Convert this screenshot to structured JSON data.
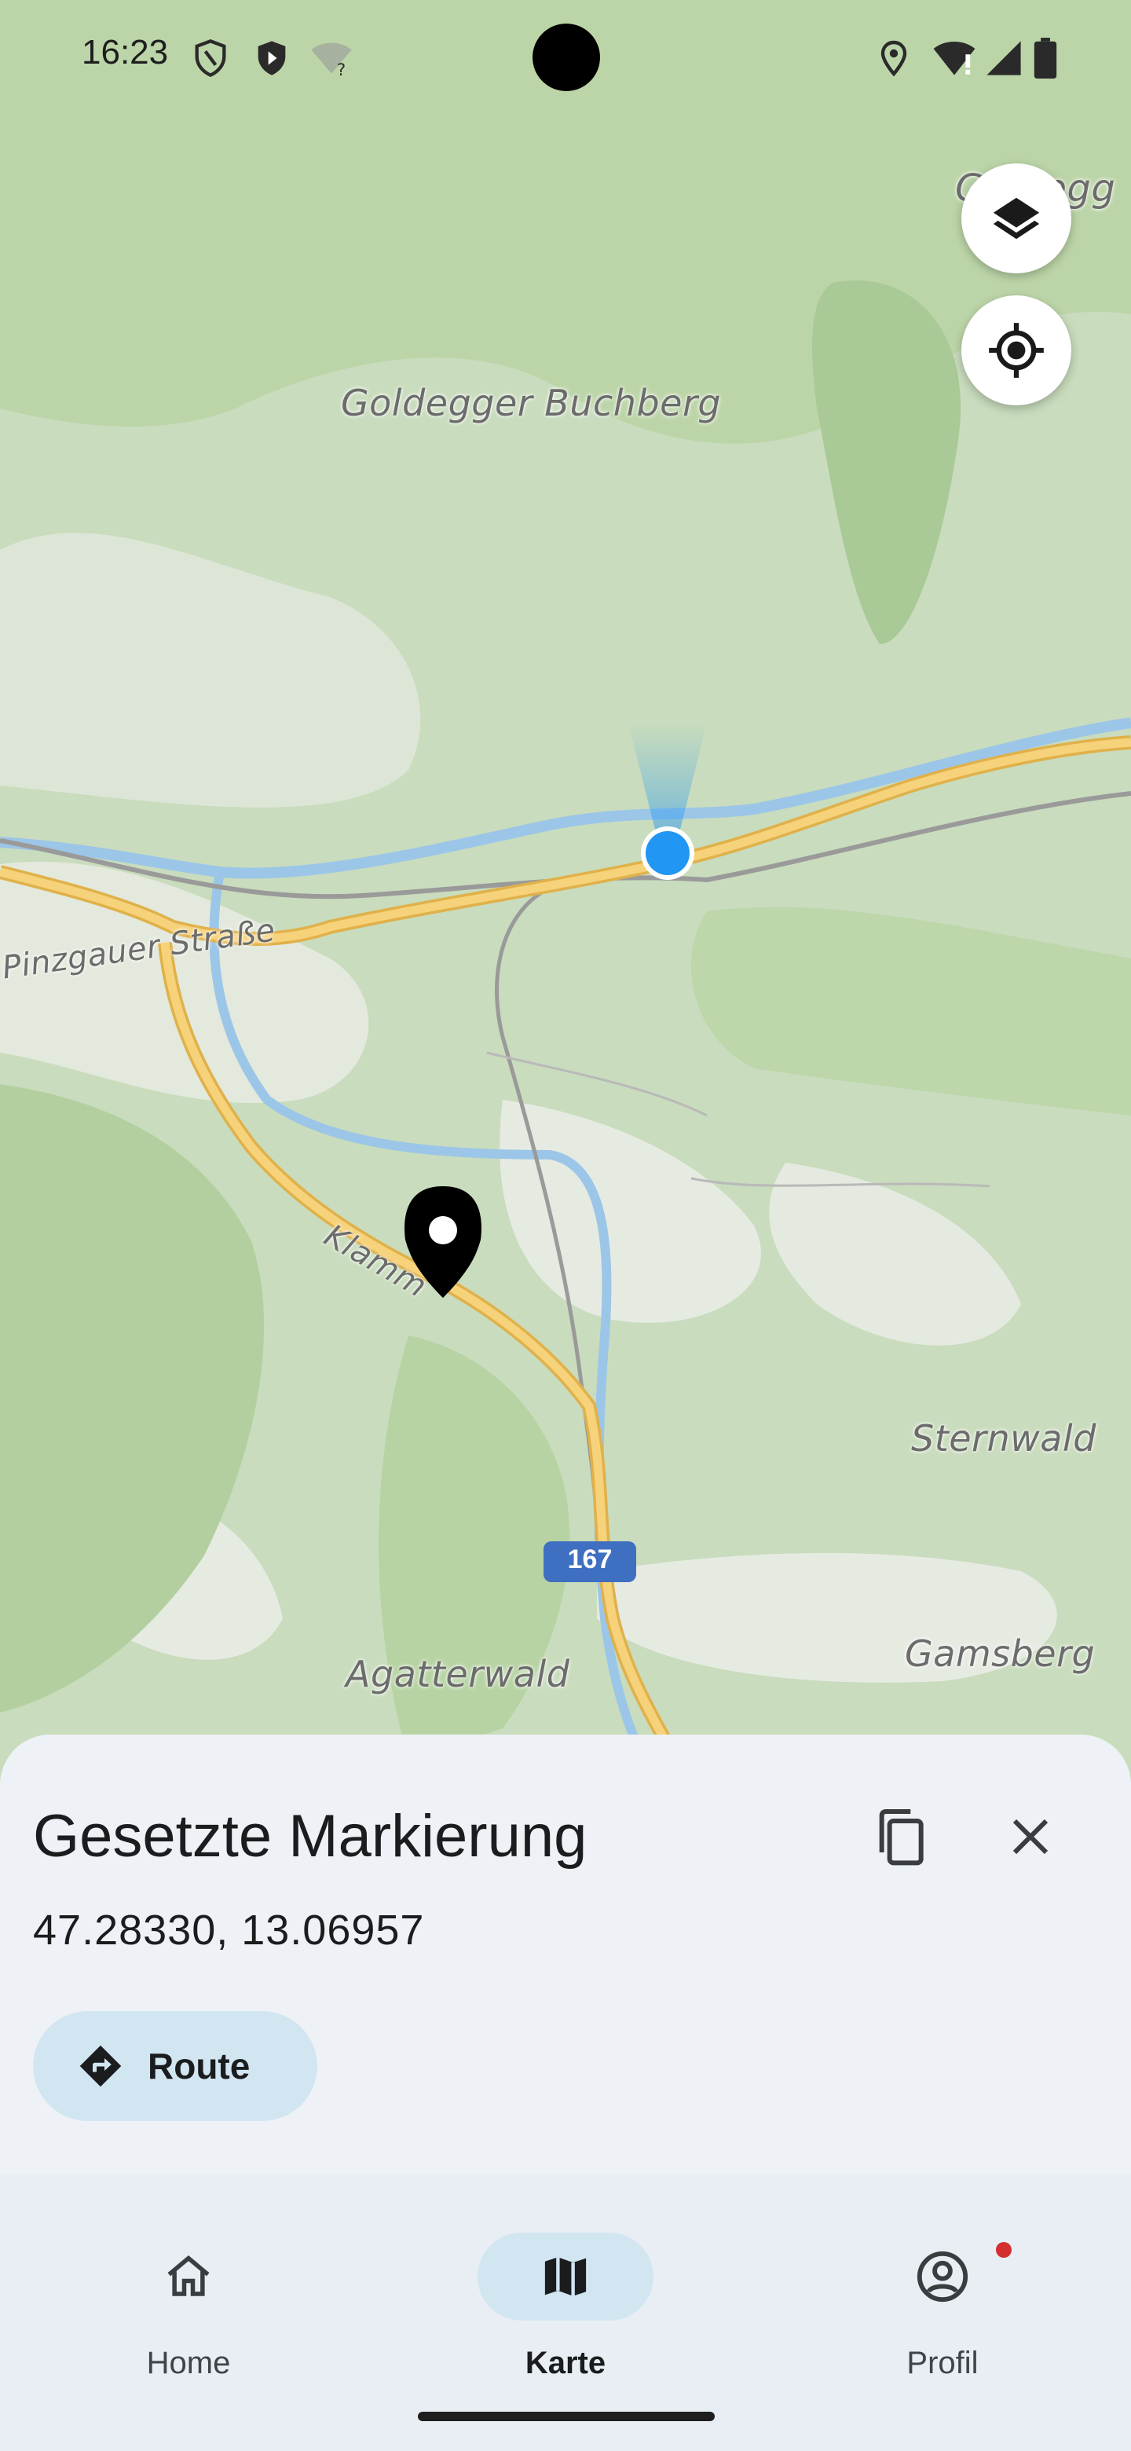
{
  "status_bar": {
    "time": "16:23",
    "icons": [
      "shield-outline-icon",
      "shield-play-icon",
      "wifi-question-icon",
      "location-icon",
      "wifi-alert-icon",
      "signal-icon",
      "battery-icon"
    ]
  },
  "map": {
    "labels": {
      "goldegger_buchberg": "Goldegger Buchberg",
      "goldegg_partial": "Goldegg",
      "pinzgauer_strasse": "Pinzgauer Straße",
      "klamm": "Klamm",
      "sternwald": "Sternwald",
      "agatterwald": "Agatterwald",
      "gamsberg": "Gamsberg",
      "road_number": "167"
    },
    "colors": {
      "accent_location": "#2196f3",
      "road": "#f6c85f",
      "river": "#9cc6e8",
      "forest": "#b7d3a4"
    }
  },
  "controls": {
    "layers_icon": "layers-icon",
    "my_location_icon": "my-location-icon"
  },
  "sheet": {
    "title": "Gesetzte Markierung",
    "coordinates": "47.28330, 13.06957",
    "route_label": "Route"
  },
  "nav": {
    "items": [
      {
        "label": "Home",
        "icon": "home-icon",
        "active": false
      },
      {
        "label": "Karte",
        "icon": "map-icon",
        "active": true
      },
      {
        "label": "Profil",
        "icon": "account-circle-icon",
        "active": false,
        "badge": true
      }
    ]
  }
}
